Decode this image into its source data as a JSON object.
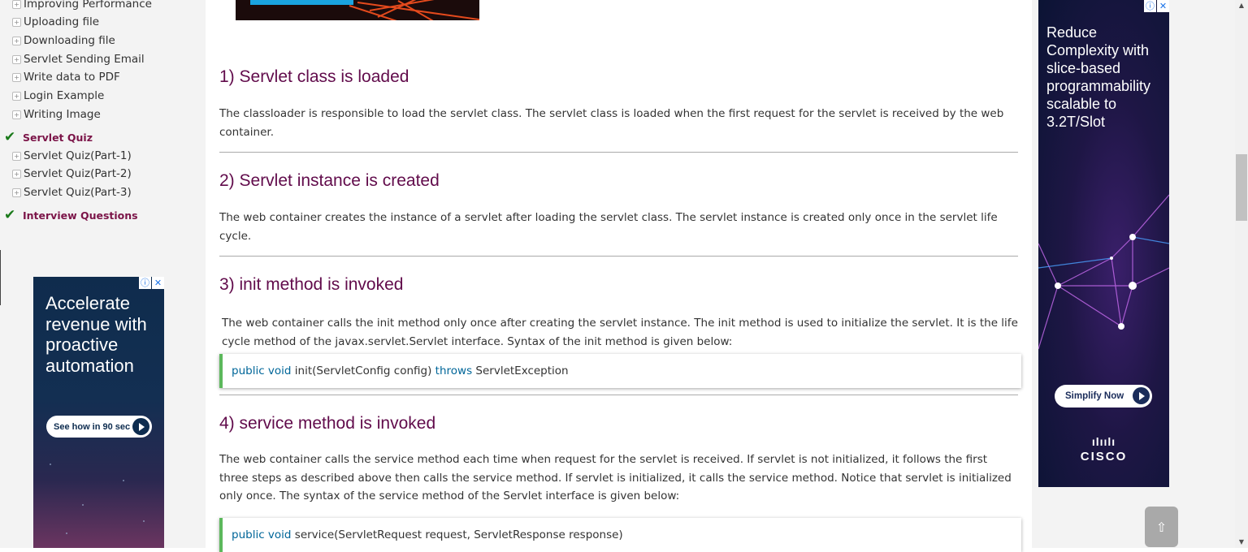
{
  "sidebar": {
    "items": [
      {
        "label": "Improving Performance"
      },
      {
        "label": "Uploading file"
      },
      {
        "label": "Downloading file"
      },
      {
        "label": "Servlet Sending Email"
      },
      {
        "label": "Write data to PDF"
      },
      {
        "label": "Login Example"
      },
      {
        "label": "Writing Image"
      }
    ],
    "quiz_heading": "Servlet Quiz",
    "quiz_items": [
      {
        "label": "Servlet Quiz(Part-1)"
      },
      {
        "label": "Servlet Quiz(Part-2)"
      },
      {
        "label": "Servlet Quiz(Part-3)"
      }
    ],
    "interview_heading": "Interview Questions"
  },
  "left_ad": {
    "text": "Accelerate revenue with proactive automation",
    "cta": "See how in 90 sec"
  },
  "main": {
    "sections": [
      {
        "title": "1) Servlet class is loaded",
        "body": "The classloader is responsible to load the servlet class. The servlet class is loaded when the first request for the servlet is received by the web container."
      },
      {
        "title": "2) Servlet instance is created",
        "body": "The web container creates the instance of a servlet after loading the servlet class. The servlet instance is created only once in the servlet life cycle."
      },
      {
        "title": "3) init method is invoked",
        "body": "The web container calls the init method only once after creating the servlet instance. The init method is used to initialize the servlet. It is the life cycle method of the javax.servlet.Servlet interface. Syntax of the init method is given below:",
        "code": {
          "kw1": "public",
          "kw2": "void",
          "plain1": "init(ServletConfig config)",
          "kw3": "throws",
          "plain2": "ServletException"
        }
      },
      {
        "title": "4) service method is invoked",
        "body": "The web container calls the service method each time when request for the servlet is received. If servlet is not initialized, it follows the first three steps as described above then calls the service method. If servlet is initialized, it calls the service method. Notice that servlet is initialized only once. The syntax of the service method of the Servlet interface is given below:",
        "code": {
          "kw1": "public",
          "kw2": "void",
          "plain1": "service(ServletRequest request, ServletResponse response)"
        }
      }
    ]
  },
  "right_ad": {
    "text": "Reduce Complexity with slice-based programmability scalable to 3.2T/Slot",
    "cta": "Simplify Now",
    "brand_bars": "ılıılı",
    "brand": "CISCO"
  },
  "ad_choices": {
    "info": "ⓘ",
    "close": "✕"
  },
  "scroll_top": "⇧",
  "colors": {
    "heading": "#610b4b",
    "sidebar_heading": "#7b1448",
    "code_border": "#5cb85c",
    "keyword": "#006699"
  }
}
